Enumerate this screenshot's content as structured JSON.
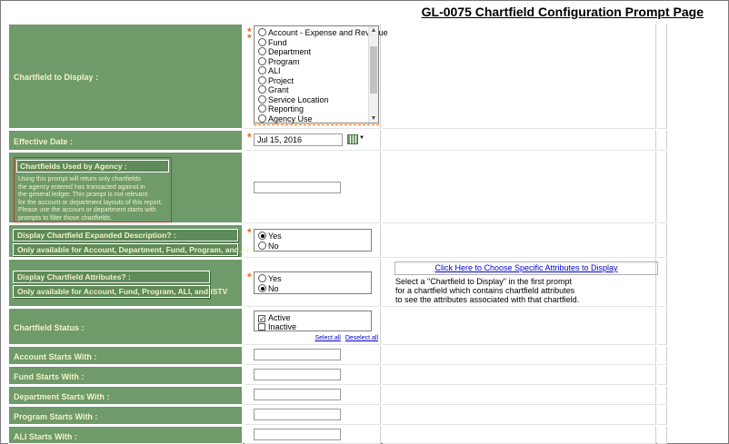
{
  "page": {
    "title": "GL-0075 Chartfield Configuration Prompt Page"
  },
  "chartfield_to_display": {
    "label": "Chartfield to Display :",
    "options": [
      "Account - Expense and Revenue",
      "Fund",
      "Department",
      "Program",
      "ALI",
      "Project",
      "Grant",
      "Service Location",
      "Reporting",
      "Agency Use"
    ]
  },
  "effective_date": {
    "label": "Effective Date :",
    "value": "Jul 15, 2016",
    "calendar_icon": "calendar-icon"
  },
  "chartfields_used": {
    "label": "Chartfields Used by Agency :",
    "description": [
      "Using this prompt will return only chartfields",
      "the agency entered has transacted against in",
      "the general ledger. This prompt is not relevant",
      "for the account or department layouts of this report.",
      "Please use the account or department starts with",
      "prompts to filter those chartfields."
    ]
  },
  "expanded_description": {
    "label": "Display Chartfield Expanded Description? :",
    "note": "Only available for Account, Department, Fund, Program, and ALI",
    "options": [
      "Yes",
      "No"
    ],
    "selected": "Yes"
  },
  "attributes": {
    "label": "Display Chartfield Attributes? :",
    "note": "Only available for Account, Fund, Program, ALI, and ISTV",
    "options": [
      "Yes",
      "No"
    ],
    "selected": "No",
    "link": "Click Here to Choose Specific Attributes to Display",
    "help": [
      "Select a \"Chartfield to Display\" in the first prompt",
      "for a chartfield which contains chartfield attributes",
      "to see the attributes associated with that chartfield."
    ]
  },
  "status": {
    "label": "Chartfield Status :",
    "options": [
      {
        "label": "Active",
        "checked": true
      },
      {
        "label": "Inactive",
        "checked": false
      }
    ],
    "select_all": "Select all",
    "deselect_all": "Deselect all"
  },
  "starts_with": [
    {
      "label": "Account Starts With :"
    },
    {
      "label": "Fund Starts With :"
    },
    {
      "label": "Department Starts With :"
    },
    {
      "label": "Program Starts With :"
    },
    {
      "label": "ALI Starts With :"
    }
  ]
}
